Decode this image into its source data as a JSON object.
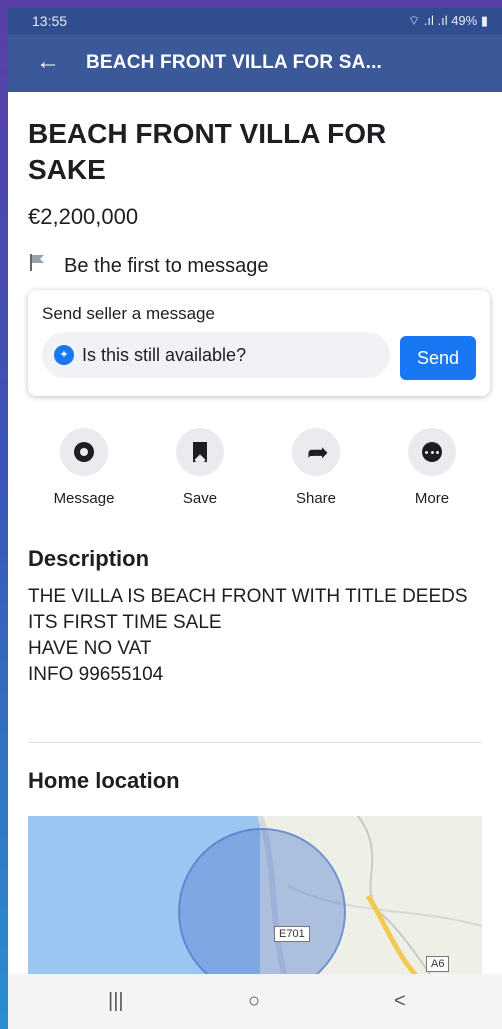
{
  "status_bar": {
    "time": "13:55",
    "indicators": "⌔ .ıl .ıl 49% ▮"
  },
  "app_bar": {
    "back_icon": "←",
    "title": "BEACH FRONT VILLA FOR SA..."
  },
  "listing": {
    "title": "BEACH FRONT VILLA FOR SAKE",
    "price": "€2,200,000",
    "first_message_note": "Be the first to message"
  },
  "message_card": {
    "label": "Send seller a message",
    "input_value": "Is this still available?",
    "send_label": "Send"
  },
  "actions": [
    {
      "label": "Message",
      "icon": "messenger-icon"
    },
    {
      "label": "Save",
      "icon": "bookmark-icon"
    },
    {
      "label": "Share",
      "icon": "share-icon"
    },
    {
      "label": "More",
      "icon": "more-icon"
    }
  ],
  "description": {
    "heading": "Description",
    "lines": [
      "THE VILLA IS BEACH FRONT WITH TITLE DEEDS",
      "ITS FIRST TIME SALE",
      "HAVE NO VAT",
      "INFO 99655104"
    ]
  },
  "location": {
    "heading": "Home location",
    "road_labels": [
      "E701",
      "A6"
    ]
  },
  "nav_bar": {
    "recents": "|||",
    "home": "○",
    "back": "<"
  },
  "colors": {
    "app_bar": "#3b5998",
    "accent": "#1877f2",
    "text": "#1c1e21"
  }
}
